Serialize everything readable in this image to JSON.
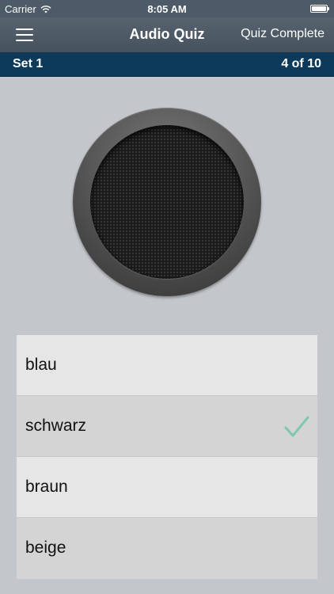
{
  "status": {
    "carrier": "Carrier",
    "time": "8:05 AM"
  },
  "nav": {
    "title": "Audio Quiz",
    "right_label": "Quiz Complete"
  },
  "set": {
    "name": "Set 1",
    "progress": "4 of 10"
  },
  "answers": [
    {
      "label": "blau",
      "selected": false
    },
    {
      "label": "schwarz",
      "selected": true
    },
    {
      "label": "braun",
      "selected": false
    },
    {
      "label": "beige",
      "selected": false
    }
  ],
  "icons": {
    "menu": "hamburger-menu-icon",
    "speaker": "speaker-icon",
    "check": "checkmark-icon"
  },
  "colors": {
    "check": "#7ec8ad",
    "set_bar": "#0d3a5a",
    "nav_bar": "#4d5a67"
  }
}
